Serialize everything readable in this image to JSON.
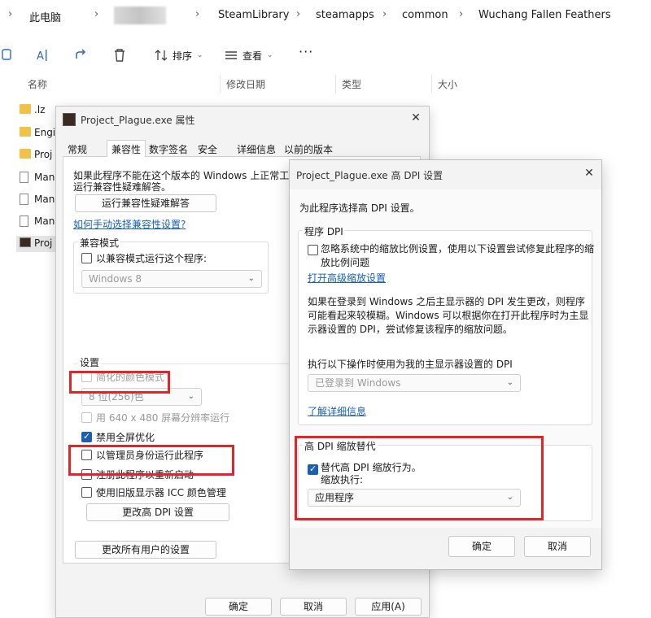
{
  "explorer": {
    "breadcrumbs": [
      "此电脑",
      "SteamLibrary",
      "steamapps",
      "common",
      "Wuchang Fallen Feathers"
    ],
    "toolbar": {
      "sort_label": "排序",
      "view_label": "查看",
      "more_label": "···"
    },
    "columns": [
      "名称",
      "修改日期",
      "类型",
      "大小"
    ],
    "files": [
      ".lz",
      "Engi",
      "Proj",
      "Man",
      "Man",
      "Man",
      "Proj"
    ]
  },
  "props": {
    "title": "Project_Plague.exe 属性",
    "tabs": [
      "常规",
      "兼容性",
      "数字签名",
      "安全",
      "详细信息",
      "以前的版本"
    ],
    "intro_line1": "如果此程序不能在这个版本的 Windows 上正常工作，",
    "intro_line2": "运行兼容性疑难解答。",
    "troubleshoot_button": "运行兼容性疑难解答",
    "manual_link": "如何手动选择兼容性设置?",
    "compat_group": "兼容模式",
    "compat_checkbox": "以兼容模式运行这个程序:",
    "compat_select": "Windows 8",
    "settings_group": "设置",
    "reduced_color": "简化的颜色模式",
    "color_select": "8 位(256)色",
    "res_640": "用 640 x 480 屏幕分辨率运行",
    "disable_fullscreen": "禁用全屏优化",
    "run_as_admin": "以管理员身份运行此程序",
    "register_restart": "注册此程序以重新启动",
    "legacy_icc": "使用旧版显示器 ICC 颜色管理",
    "change_dpi_button": "更改高 DPI 设置",
    "all_users_button": "更改所有用户的设置",
    "ok_button": "确定",
    "cancel_button": "取消",
    "apply_button": "应用(A)"
  },
  "dpi": {
    "title": "Project_Plague.exe 高 DPI 设置",
    "choose_text": "为此程序选择高 DPI 设置。",
    "program_dpi_group": "程序 DPI",
    "override_system_line1": "忽略系统中的缩放比例设置，使用以下设置尝试修复此程序的缩",
    "override_system_line2": "放比例问题",
    "advanced_link": "打开高级缩放设置",
    "explain_line1": "如果在登录到 Windows 之后主显示器的 DPI 发生更改，则程序",
    "explain_line2": "可能看起来较模糊。Windows 可以根据你在打开此程序时为主显",
    "explain_line3": "示器设置的 DPI，尝试修复该程序的缩放问题。",
    "use_dpi_label": "执行以下操作时使用为我的主显示器设置的 DPI",
    "use_dpi_select": "已登录到 Windows",
    "learn_more_link": "了解详细信息",
    "override_group": "高 DPI 缩放替代",
    "override_checkbox": "替代高 DPI 缩放行为。",
    "scaling_label": "缩放执行:",
    "scaling_select": "应用程序",
    "ok_button": "确定",
    "cancel_button": "取消"
  },
  "colors": {
    "highlight_red": "#e0262a",
    "accent_blue": "#1a5fb4"
  }
}
